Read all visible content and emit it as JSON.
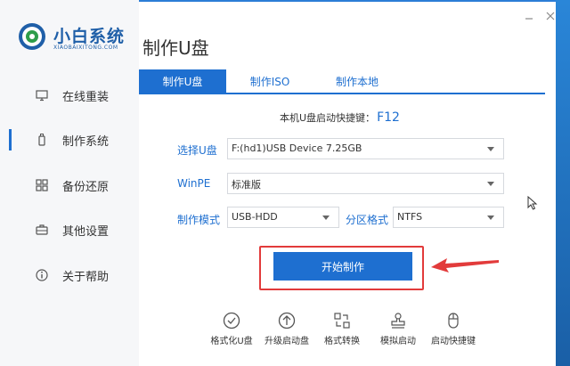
{
  "app": {
    "name": "小白系统",
    "subtitle": "XIAOBAIXITONG.COM"
  },
  "sidebar": {
    "items": [
      {
        "label": "在线重装",
        "icon": "monitor-icon"
      },
      {
        "label": "制作系统",
        "icon": "usb-drive-icon",
        "active": true
      },
      {
        "label": "备份还原",
        "icon": "backup-grid-icon"
      },
      {
        "label": "其他设置",
        "icon": "toolbox-icon"
      },
      {
        "label": "关于帮助",
        "icon": "info-icon"
      }
    ]
  },
  "page": {
    "title": "制作U盘"
  },
  "tabs": [
    {
      "label": "制作U盘",
      "active": true
    },
    {
      "label": "制作ISO"
    },
    {
      "label": "制作本地"
    }
  ],
  "hotkey": {
    "text": "本机U盘启动快捷键：",
    "key": "F12"
  },
  "form": {
    "usb": {
      "label": "选择U盘",
      "value": "F:(hd1)USB Device 7.25GB"
    },
    "winpe": {
      "label": "WinPE",
      "value": "标准版"
    },
    "mode": {
      "label": "制作模式",
      "value": "USB-HDD"
    },
    "partition": {
      "label": "分区格式",
      "value": "NTFS"
    }
  },
  "start_button": {
    "label": "开始制作"
  },
  "tools": [
    {
      "label": "格式化U盘",
      "icon": "check-circle-icon"
    },
    {
      "label": "升级启动盘",
      "icon": "upload-circle-icon"
    },
    {
      "label": "格式转换",
      "icon": "convert-icon"
    },
    {
      "label": "模拟启动",
      "icon": "stamp-icon"
    },
    {
      "label": "启动快捷键",
      "icon": "mouse-icon"
    }
  ],
  "colors": {
    "accent": "#1e6fd0",
    "highlight": "#e23b3b",
    "sidebar_bg": "#f6f7f9"
  }
}
